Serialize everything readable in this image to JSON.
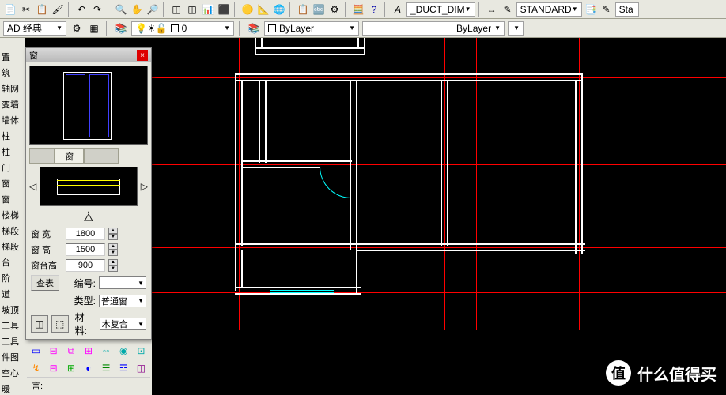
{
  "toolbar": {
    "style1": "_DUCT_DIM",
    "style2": "STANDARD",
    "style3": "Sta"
  },
  "toolbar2": {
    "mode": "AD 经典",
    "layer": "0",
    "color": "ByLayer",
    "linetype": "ByLayer"
  },
  "sidebar": {
    "items": [
      "置",
      "筑",
      "轴网",
      "变墙",
      "墙体",
      "柱",
      "柱",
      "门",
      "窗",
      "窗",
      "楼梯",
      "梯段",
      "梯段",
      "台",
      "阶",
      "道",
      "坡顶",
      "工具",
      "工具",
      "件图",
      "空心",
      "暖"
    ]
  },
  "panel": {
    "title": "窗",
    "tab1": "窗",
    "params": {
      "width_label": "窗 宽",
      "width_value": "1800",
      "height_label": "窗 高",
      "height_value": "1500",
      "sill_label": "窗台高",
      "sill_value": "900"
    },
    "lookup_btn": "查表",
    "number_label": "编号:",
    "number_value": "",
    "type_label": "类型:",
    "type_value": "普通窗",
    "material_label": "材料:",
    "material_value": "木复合"
  },
  "status": {
    "text": "言:"
  },
  "watermark": {
    "char": "值",
    "text": "什么值得买"
  }
}
